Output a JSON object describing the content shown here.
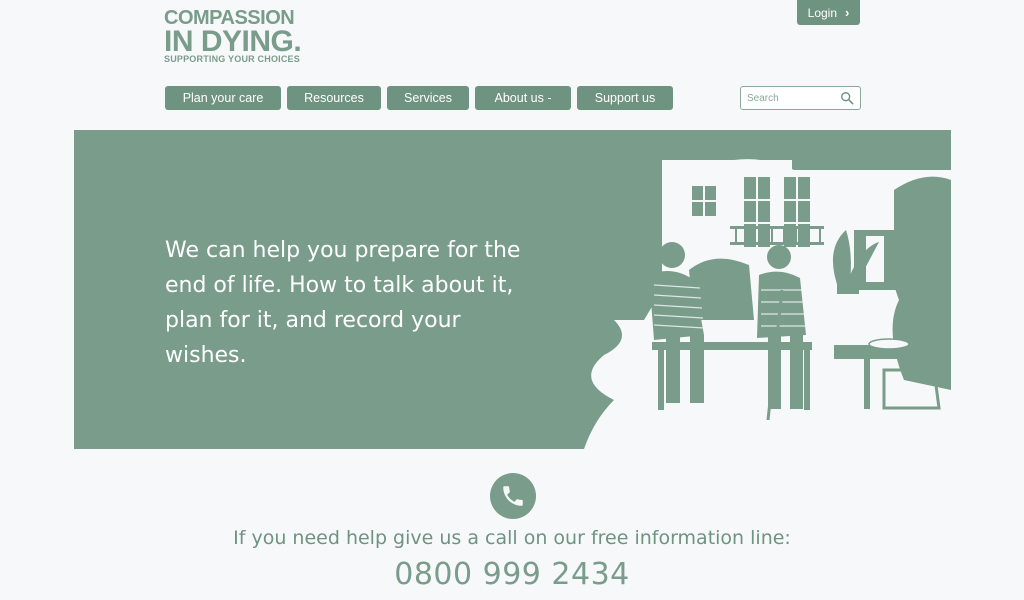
{
  "brand": {
    "line1": "COMPASSION",
    "line2": "IN DYING.",
    "tagline": "SUPPORTING YOUR CHOICES"
  },
  "header": {
    "login_label": "Login"
  },
  "nav": [
    {
      "label": "Plan your care"
    },
    {
      "label": "Resources"
    },
    {
      "label": "Services"
    },
    {
      "label": "About us -"
    },
    {
      "label": "Support us"
    }
  ],
  "search": {
    "placeholder": "Search"
  },
  "hero": {
    "text": "We can help you prepare for the end of life. How to talk about it, plan for it, and record your wishes."
  },
  "helpline": {
    "text": "If you need help give us a call on our free information line:",
    "number": "0800 999 2434"
  },
  "colors": {
    "accent": "#6f9381",
    "hero_bg": "#7a9c8b",
    "page_bg": "#f7f8fa"
  }
}
